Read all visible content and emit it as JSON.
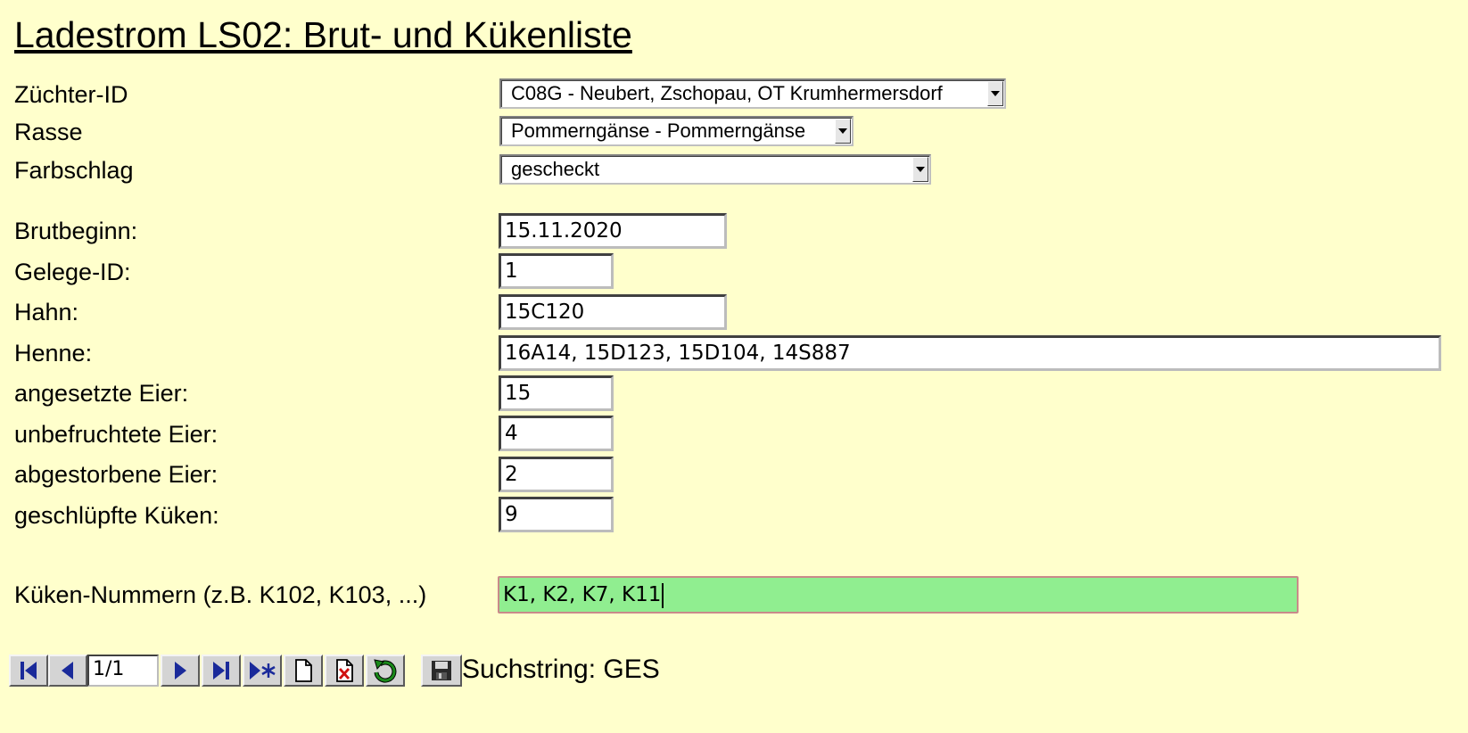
{
  "page": {
    "title": "Ladestrom LS02: Brut- und Kükenliste"
  },
  "selects": {
    "zuechter": {
      "label": "Züchter-ID",
      "value": "C08G - Neubert, Zschopau, OT Krumhermersdorf"
    },
    "rasse": {
      "label": "Rasse",
      "value": "Pommerngänse - Pommerngänse"
    },
    "farbschlag": {
      "label": "Farbschlag",
      "value": "gescheckt"
    }
  },
  "fields": {
    "brutbeginn": {
      "label": "Brutbeginn:",
      "value": "15.11.2020"
    },
    "gelege": {
      "label": "Gelege-ID:",
      "value": "1"
    },
    "hahn": {
      "label": "Hahn:",
      "value": "15C120"
    },
    "henne": {
      "label": "Henne:",
      "value": "16A14, 15D123, 15D104, 14S887"
    },
    "angesetzt": {
      "label": "angesetzte Eier:",
      "value": "15"
    },
    "unbefruchtet": {
      "label": "unbefruchtete Eier:",
      "value": "4"
    },
    "abgestorben": {
      "label": "abgestorbene Eier:",
      "value": "2"
    },
    "geschluepft": {
      "label": "geschlüpfte Küken:",
      "value": "9"
    },
    "kueken_nummern": {
      "label": "Küken-Nummern (z.B. K102, K103, ...)",
      "value": "K1, K2, K7, K11"
    }
  },
  "navigation": {
    "record_indicator": "1/1",
    "search_text": "Suchstring: GES",
    "icons": [
      "first-record-icon",
      "prev-record-icon",
      "next-record-icon",
      "last-record-icon",
      "new-record-icon",
      "new-document-icon",
      "delete-record-icon",
      "refresh-icon",
      "save-icon"
    ]
  },
  "colors": {
    "background": "#ffffcc",
    "active_field": "#90ee90",
    "nav_icon_blue": "#1a2a9a",
    "refresh_green": "#1a8a1a",
    "delete_red": "#d01010"
  }
}
